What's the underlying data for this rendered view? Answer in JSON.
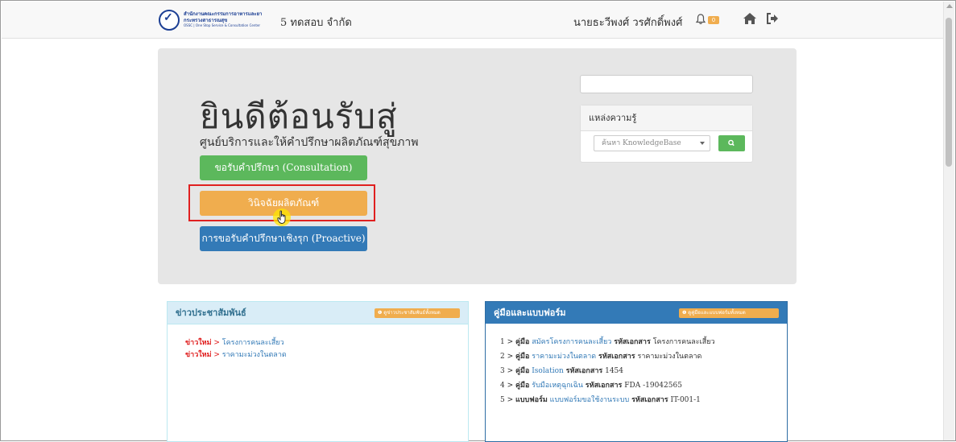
{
  "header": {
    "logo": {
      "line1": "สำนักงานคณะกรรมการอาหารและยา",
      "line2": "กระทรวงสาธารณสุข",
      "line3": "OSSC | One Stop Service & Consultation Center"
    },
    "company": "5 ทดสอบ จำกัด",
    "username": "นายธะวีพงศ์ วรศักดิ์พงศ์",
    "notification_count": "0"
  },
  "hero": {
    "title": "ยินดีต้อนรับสู่",
    "subtitle": "ศูนย์บริการและให้คำปรึกษาผลิตภัณฑ์สุขภาพ",
    "btn_consult": "ขอรับคำปรึกษา (Consultation)",
    "btn_research": "วินิจฉัยผลิตภัณฑ์",
    "btn_proactive": "การขอรับคำปรึกษาเชิงรุก (Proactive)"
  },
  "knowledge": {
    "heading": "แหล่งความรู้",
    "select_placeholder": "ค้นหา KnowledgeBase"
  },
  "news": {
    "heading": "ข่าวประชาสัมพันธ์",
    "badge": "ดูข่าวประชาสัมพันธ์ทั้งหมด",
    "items": [
      {
        "tag": "ข่าวใหม่",
        "sep": " > ",
        "title": "โครงการคนละเสี้ยว"
      },
      {
        "tag": "ข่าวใหม่",
        "sep": " > ",
        "title": "ราคามะม่วงในตลาด"
      }
    ]
  },
  "manuals": {
    "heading": "คู่มือและแบบฟอร์ม",
    "badge": "ดูคู่มือและแบบฟอร์มทั้งหมด",
    "doc_label": "รหัสเอกสาร",
    "items": [
      {
        "num": "1 > ",
        "type": "คู่มือ",
        "link": "สมัครโครงการคนละเสี้ยว",
        "code": "โครงการคนละเสี้ยว"
      },
      {
        "num": "2 > ",
        "type": "คู่มือ",
        "link": "ราคามะม่วงในตลาด",
        "code": "ราคามะม่วงในตลาด"
      },
      {
        "num": "3 > ",
        "type": "คู่มือ",
        "link": "Isolation",
        "code": "1454"
      },
      {
        "num": "4 > ",
        "type": "คู่มือ",
        "link": "รับมือเหตุฉุกเฉิน",
        "code": "FDA -19042565"
      },
      {
        "num": "5 > ",
        "type": "แบบฟอร์ม",
        "link": "แบบฟอร์มขอใช้งานระบบ",
        "code": "IT-001-1"
      }
    ]
  },
  "colors": {
    "green": "#5cb85c",
    "orange": "#f0ad4e",
    "blue": "#337ab7",
    "highlight": "#e02020"
  }
}
